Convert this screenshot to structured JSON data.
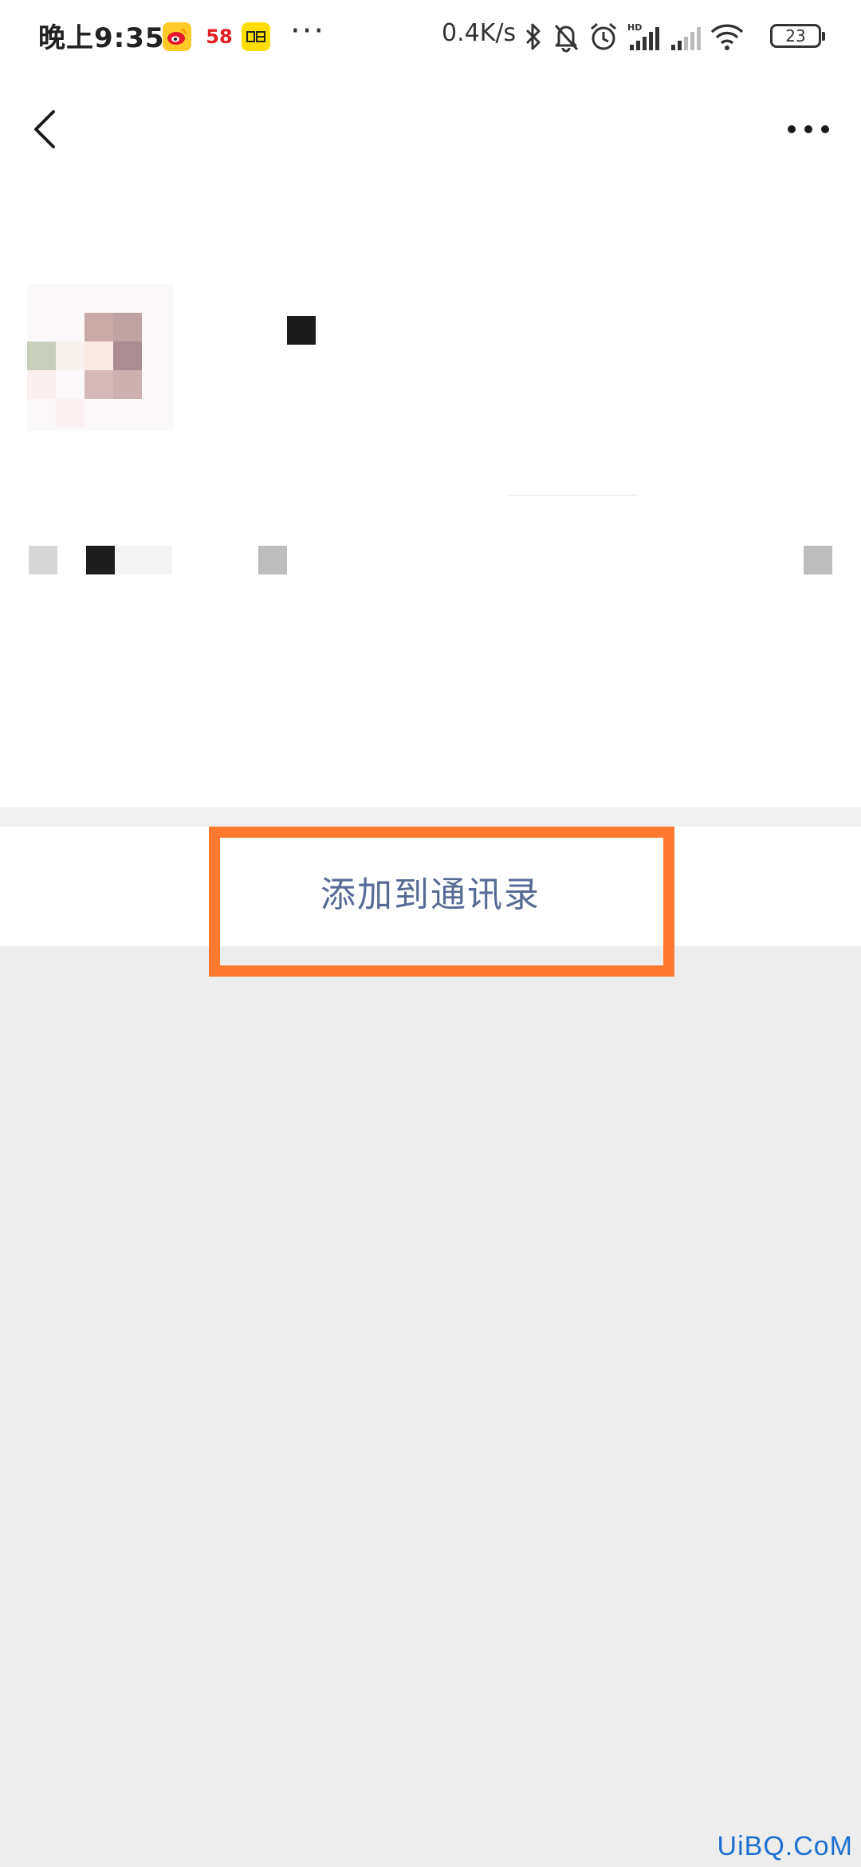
{
  "status_bar": {
    "time": "晚上9:35",
    "app_icons": [
      "weibo-icon",
      "app-58-icon",
      "yellow-app-icon"
    ],
    "app_58_label": "58",
    "more": "···",
    "network_speed": "0.4K/s",
    "status_icons": [
      "bluetooth-icon",
      "mute-bell-icon",
      "alarm-icon",
      "signal-hd-icon",
      "signal-icon",
      "wifi-icon"
    ],
    "battery": "23"
  },
  "nav": {
    "back_icon": "chevron-left-icon",
    "more_icon": "more-dots-icon"
  },
  "profile": {
    "avatar_icon": "pixelated-avatar",
    "name_mask_color": "#1b1b1b"
  },
  "action": {
    "add_to_contacts": "添加到通讯录",
    "highlight_color": "#ff7a2f"
  },
  "watermark": "UiBQ.CoM"
}
